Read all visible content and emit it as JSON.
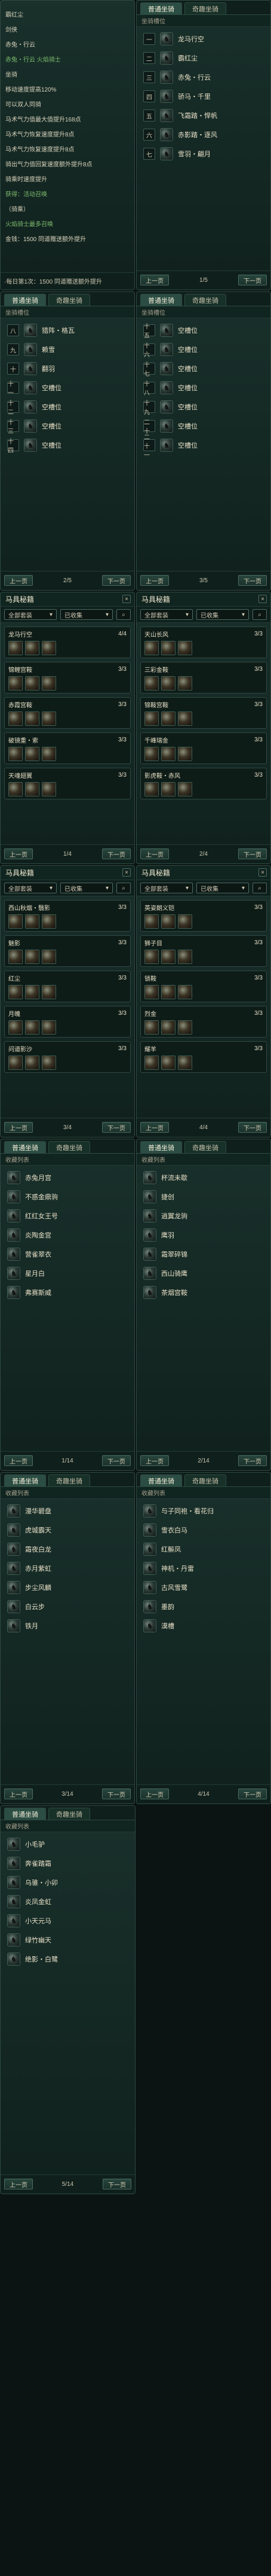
{
  "top_text_panel": {
    "lines": [
      "霸红尘",
      "剑侠",
      "赤兔・行云",
      "赤兔・行云  火焰骑士",
      "坐骑",
      "移动速度提高120%",
      "可以双人同骑",
      "马术气力值最大值提升168点",
      "马术气力恢复速度提升8点",
      "马术气力恢复速度提升8点",
      "骑出气力值回复速度额外提升8点",
      "骑乘时速度提升",
      "获得：活动召唤",
      "（骑乘）",
      "火焰骑士最多召唤",
      "金钱：1500  同道赠送额外提升"
    ],
    "footer_note": "·每日第1次：1500 同道赠送额外提升"
  },
  "mount_panel_1": {
    "tabs": [
      "普通坐骑",
      "奇趣坐骑"
    ],
    "subheader": "坐骑槽位",
    "rows": [
      {
        "index": "一",
        "icon": "horse-icon",
        "name": "龙马行空"
      },
      {
        "index": "二",
        "icon": "horse-icon",
        "name": "霸红尘"
      },
      {
        "index": "三",
        "icon": "horse-icon",
        "name": "赤兔・行云"
      },
      {
        "index": "四",
        "icon": "horse-icon",
        "name": "骄马・千里"
      },
      {
        "index": "五",
        "icon": "horse-icon",
        "name": "飞霜踏・悍帆"
      },
      {
        "index": "六",
        "icon": "horse-icon",
        "name": "赤影踏・逐风"
      },
      {
        "index": "七",
        "icon": "horse-icon",
        "name": "雪羽・翩月"
      }
    ],
    "pagination": {
      "prev": "上一页",
      "page": "1/5",
      "next": "下一页"
    }
  },
  "mount_panel_2": {
    "left": {
      "tabs": [
        "普通坐骑",
        "奇趣坐骑"
      ],
      "subheader": "坐骑槽位",
      "rows": [
        {
          "index": "八",
          "icon": "horse-icon",
          "name": "猎阵・格瓦"
        },
        {
          "index": "九",
          "icon": "horse-icon",
          "name": "赖雪"
        },
        {
          "index": "十",
          "icon": "horse-icon",
          "name": "翻羽"
        },
        {
          "index": "十一",
          "icon": "horse-icon",
          "name": "空槽位"
        },
        {
          "index": "十二",
          "icon": "horse-icon",
          "name": "空槽位"
        },
        {
          "index": "十三",
          "icon": "horse-icon",
          "name": "空槽位"
        },
        {
          "index": "十四",
          "icon": "horse-icon",
          "name": "空槽位"
        }
      ],
      "pagination": {
        "prev": "上一页",
        "page": "2/5",
        "next": "下一页"
      }
    },
    "right": {
      "tabs": [
        "普通坐骑",
        "奇趣坐骑"
      ],
      "subheader": "坐骑槽位",
      "rows": [
        {
          "index": "十五",
          "icon": "horse-icon",
          "name": "空槽位"
        },
        {
          "index": "十六",
          "icon": "horse-icon",
          "name": "空槽位"
        },
        {
          "index": "十七",
          "icon": "horse-icon",
          "name": "空槽位"
        },
        {
          "index": "十八",
          "icon": "horse-icon",
          "name": "空槽位"
        },
        {
          "index": "十九",
          "icon": "horse-icon",
          "name": "空槽位"
        },
        {
          "index": "二十",
          "icon": "horse-icon",
          "name": "空槽位"
        },
        {
          "index": "二十一",
          "icon": "horse-icon",
          "name": "空槽位"
        }
      ],
      "pagination": {
        "prev": "上一页",
        "page": "3/5",
        "next": "下一页"
      }
    }
  },
  "horse_panel_1": {
    "left": {
      "title": "马具秘籍",
      "close": "×",
      "filters": {
        "left": "全部套装",
        "right": "已收集"
      },
      "cards": [
        {
          "name": "龙马行空",
          "count": "4/4"
        },
        {
          "name": "锦鲤宫鞍",
          "count": "3/3"
        },
        {
          "name": "赤霞宫鞍",
          "count": "3/3"
        },
        {
          "name": "破镜重・索",
          "count": "3/3"
        },
        {
          "name": "天魂翅翼",
          "count": "3/3"
        }
      ],
      "pagination": {
        "prev": "上一页",
        "page": "1/4",
        "next": "下一页"
      }
    },
    "right": {
      "title": "马具秘籍",
      "close": "×",
      "filters": {
        "left": "全部套装",
        "right": "已收集"
      },
      "cards": [
        {
          "name": "天山长风",
          "count": "3/3"
        },
        {
          "name": "三彩金鞍",
          "count": "3/3"
        },
        {
          "name": "锦鞍宫鞍",
          "count": "3/3"
        },
        {
          "name": "千峰瑞金",
          "count": "3/3"
        },
        {
          "name": "影虎鞍・赤风",
          "count": "3/3"
        }
      ],
      "pagination": {
        "prev": "上一页",
        "page": "2/4",
        "next": "下一页"
      }
    }
  },
  "horse_panel_2": {
    "left": {
      "title": "马具秘籍",
      "close": "×",
      "filters": {
        "left": "全部套装",
        "right": "已收集"
      },
      "cards": [
        {
          "name": "西山秋烟・翳影",
          "count": "3/3"
        },
        {
          "name": "魅影",
          "count": "3/3"
        },
        {
          "name": "红尘",
          "count": "3/3"
        },
        {
          "name": "月魄",
          "count": "3/3"
        },
        {
          "name": "问道影沙",
          "count": "3/3"
        }
      ],
      "pagination": {
        "prev": "上一页",
        "page": "3/4",
        "next": "下一页"
      }
    },
    "right": {
      "title": "马具秘籍",
      "close": "×",
      "filters": {
        "left": "全部套装",
        "right": "已收集"
      },
      "cards": [
        {
          "name": "英姿朗义铠",
          "count": "3/3"
        },
        {
          "name": "狮子目",
          "count": "3/3"
        },
        {
          "name": "锁鞍",
          "count": "3/3"
        },
        {
          "name": "烈金",
          "count": "3/3"
        },
        {
          "name": "耀羊",
          "count": "3/3"
        }
      ],
      "pagination": {
        "prev": "上一页",
        "page": "4/4",
        "next": "下一页"
      }
    }
  },
  "collect_panel_1": {
    "left": {
      "tabs": [
        "普通坐骑",
        "奇趣坐骑"
      ],
      "subheader": "收藏列表",
      "rows": [
        {
          "icon": "horse-icon",
          "name": "赤兔月宫"
        },
        {
          "icon": "horse-icon",
          "name": "不惑金鼎驹"
        },
        {
          "icon": "horse-icon",
          "name": "红红女王号"
        },
        {
          "icon": "horse-icon",
          "name": "炎陶金宫"
        },
        {
          "icon": "horse-icon",
          "name": "营雀翠衣"
        },
        {
          "icon": "horse-icon",
          "name": "星月白"
        },
        {
          "icon": "horse-icon",
          "name": "弗赛斯威"
        }
      ],
      "pagination": {
        "prev": "上一页",
        "page": "1/14",
        "next": "下一页"
      }
    },
    "right": {
      "tabs": [
        "普通坐骑",
        "奇趣坐骑"
      ],
      "subheader": "收藏列表",
      "rows": [
        {
          "icon": "horse-icon",
          "name": "杯流未歇"
        },
        {
          "icon": "horse-icon",
          "name": "捷创"
        },
        {
          "icon": "horse-icon",
          "name": "逍翼龙驹"
        },
        {
          "icon": "horse-icon",
          "name": "鹰羽"
        },
        {
          "icon": "horse-icon",
          "name": "霜翠碎锦"
        },
        {
          "icon": "horse-icon",
          "name": "西山骑鹰"
        },
        {
          "icon": "horse-icon",
          "name": "茶烟宫鞍"
        }
      ],
      "pagination": {
        "prev": "上一页",
        "page": "2/14",
        "next": "下一页"
      }
    }
  },
  "collect_panel_2": {
    "left": {
      "tabs": [
        "普通坐骑",
        "奇趣坐骑"
      ],
      "subheader": "收藏列表",
      "rows": [
        {
          "icon": "horse-icon",
          "name": "漫华碧盘"
        },
        {
          "icon": "horse-icon",
          "name": "虎城霸天"
        },
        {
          "icon": "horse-icon",
          "name": "霜夜白龙"
        },
        {
          "icon": "horse-icon",
          "name": "赤月紫虹"
        },
        {
          "icon": "horse-icon",
          "name": "步尘风麟"
        },
        {
          "icon": "horse-icon",
          "name": "白云步"
        },
        {
          "icon": "horse-icon",
          "name": "铁月"
        }
      ],
      "pagination": {
        "prev": "上一页",
        "page": "3/14",
        "next": "下一页"
      }
    },
    "right": {
      "tabs": [
        "普通坐骑",
        "奇趣坐骑"
      ],
      "subheader": "收藏列表",
      "rows": [
        {
          "icon": "horse-icon",
          "name": "与子同袍・看花归"
        },
        {
          "icon": "horse-icon",
          "name": "雪衣白马"
        },
        {
          "icon": "horse-icon",
          "name": "红鬃凤"
        },
        {
          "icon": "horse-icon",
          "name": "神机・丹雷"
        },
        {
          "icon": "horse-icon",
          "name": "古风雪鹭"
        },
        {
          "icon": "horse-icon",
          "name": "墨韵"
        },
        {
          "icon": "horse-icon",
          "name": "漠槽"
        }
      ],
      "pagination": {
        "prev": "上一页",
        "page": "4/14",
        "next": "下一页"
      }
    }
  },
  "collect_panel_3": {
    "tabs": [
      "普通坐骑",
      "奇趣坐骑"
    ],
    "subheader": "收藏列表",
    "rows": [
      {
        "icon": "horse-icon",
        "name": "小毛驴"
      },
      {
        "icon": "horse-icon",
        "name": "奔雀踏霜"
      },
      {
        "icon": "horse-icon",
        "name": "乌骓・小卯"
      },
      {
        "icon": "horse-icon",
        "name": "炎凤金虹"
      },
      {
        "icon": "horse-icon",
        "name": "小天元马"
      },
      {
        "icon": "horse-icon",
        "name": "绿竹幽天"
      },
      {
        "icon": "horse-icon",
        "name": "绝影・白鹭"
      }
    ],
    "pagination": {
      "prev": "上一页",
      "page": "5/14",
      "next": "下一页"
    }
  }
}
